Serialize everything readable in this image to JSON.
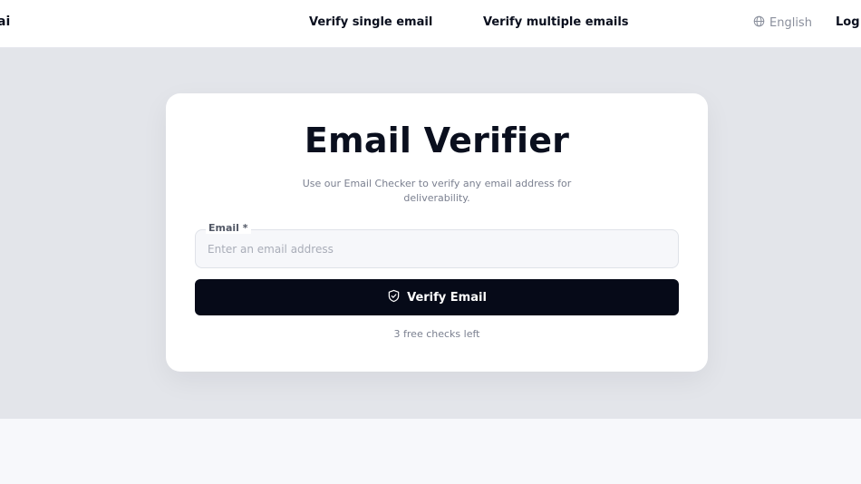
{
  "header": {
    "brand_fragment": "ai",
    "nav": {
      "single": "Verify single email",
      "multiple": "Verify multiple emails"
    },
    "language": {
      "label": "English",
      "icon": "globe-icon"
    },
    "login_fragment": "Log i"
  },
  "card": {
    "title": "Email Verifier",
    "subtitle": "Use our Email Checker to verify any email address for deliverability.",
    "email_field": {
      "label": "Email *",
      "placeholder": "Enter an email address",
      "value": ""
    },
    "button": {
      "label": "Verify Email",
      "icon": "shield-check-icon"
    },
    "checks_left": "3 free checks left"
  },
  "colors": {
    "primary": "#060a18",
    "hero_bg": "#e3e5ea",
    "muted_text": "#7b8090"
  }
}
